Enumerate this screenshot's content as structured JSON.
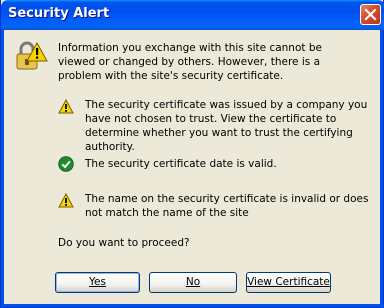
{
  "window": {
    "title": "Security Alert"
  },
  "intro": "Information you exchange with this site cannot be viewed or changed by others. However, there is a problem with the site's security certificate.",
  "items": [
    {
      "icon": "warning-icon",
      "text": "The security certificate was issued by a company you have not chosen to trust. View the certificate to determine whether you want to trust the certifying authority."
    },
    {
      "icon": "check-icon",
      "text": "The security certificate date is valid."
    },
    {
      "icon": "warning-icon",
      "text": "The name on the security certificate is invalid or does not match the name of the site"
    }
  ],
  "question": "Do you want to proceed?",
  "buttons": {
    "yes": "Yes",
    "no": "No",
    "view": "View Certificate"
  },
  "colors": {
    "titlebar": "#0054e3",
    "background": "#ece9d8",
    "warning": "#f6d400",
    "ok": "#1f8a2e"
  }
}
